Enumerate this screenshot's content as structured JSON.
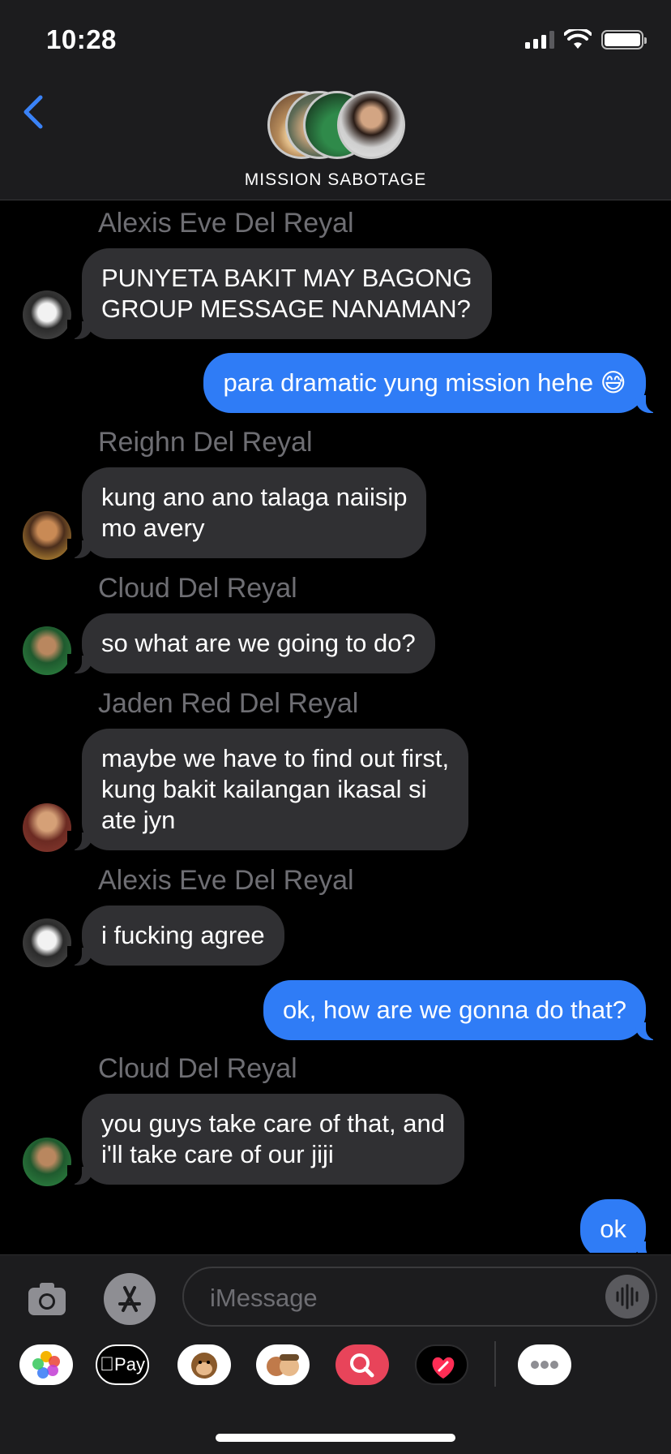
{
  "status_bar": {
    "time": "10:28"
  },
  "header": {
    "title": "MISSION SABOTAGE",
    "back_icon": "chevron-left-icon",
    "accent": "#3a82f7"
  },
  "colors": {
    "incoming_bubble": "#303033",
    "outgoing_bubble": "#2f7cf6",
    "sender_name": "#6e6e73"
  },
  "messages": [
    {
      "sender": "Alexis Eve Del Reyal",
      "text": "PUNYETA BAKIT MAY BAGONG\nGROUP MESSAGE NANAMAN?"
    },
    {
      "text": "para dramatic yung mission hehe 😅"
    },
    {
      "sender": "Reighn Del Reyal",
      "text": "kung ano ano talaga naiisip\nmo avery"
    },
    {
      "sender": "Cloud Del Reyal",
      "text": "so what are we going to do?"
    },
    {
      "sender": "Jaden Red Del Reyal",
      "text": "maybe we have to find out first,\nkung bakit kailangan ikasal si\nate jyn"
    },
    {
      "sender": "Alexis Eve Del Reyal",
      "text": "i fucking agree"
    },
    {
      "text": "ok, how are we gonna do that?"
    },
    {
      "sender": "Cloud Del Reyal",
      "text": "you guys take care of that, and\ni'll take care of our jiji"
    },
    {
      "text": "ok"
    }
  ],
  "composer": {
    "placeholder": "iMessage"
  },
  "app_drawer": [
    {
      "icon": "photos-app-icon"
    },
    {
      "icon": "apple-pay-icon",
      "label": "Pay"
    },
    {
      "icon": "animoji-monkey-icon"
    },
    {
      "icon": "memoji-icon"
    },
    {
      "icon": "image-search-icon"
    },
    {
      "icon": "digital-touch-icon"
    },
    {
      "icon": "more-apps-icon"
    }
  ]
}
